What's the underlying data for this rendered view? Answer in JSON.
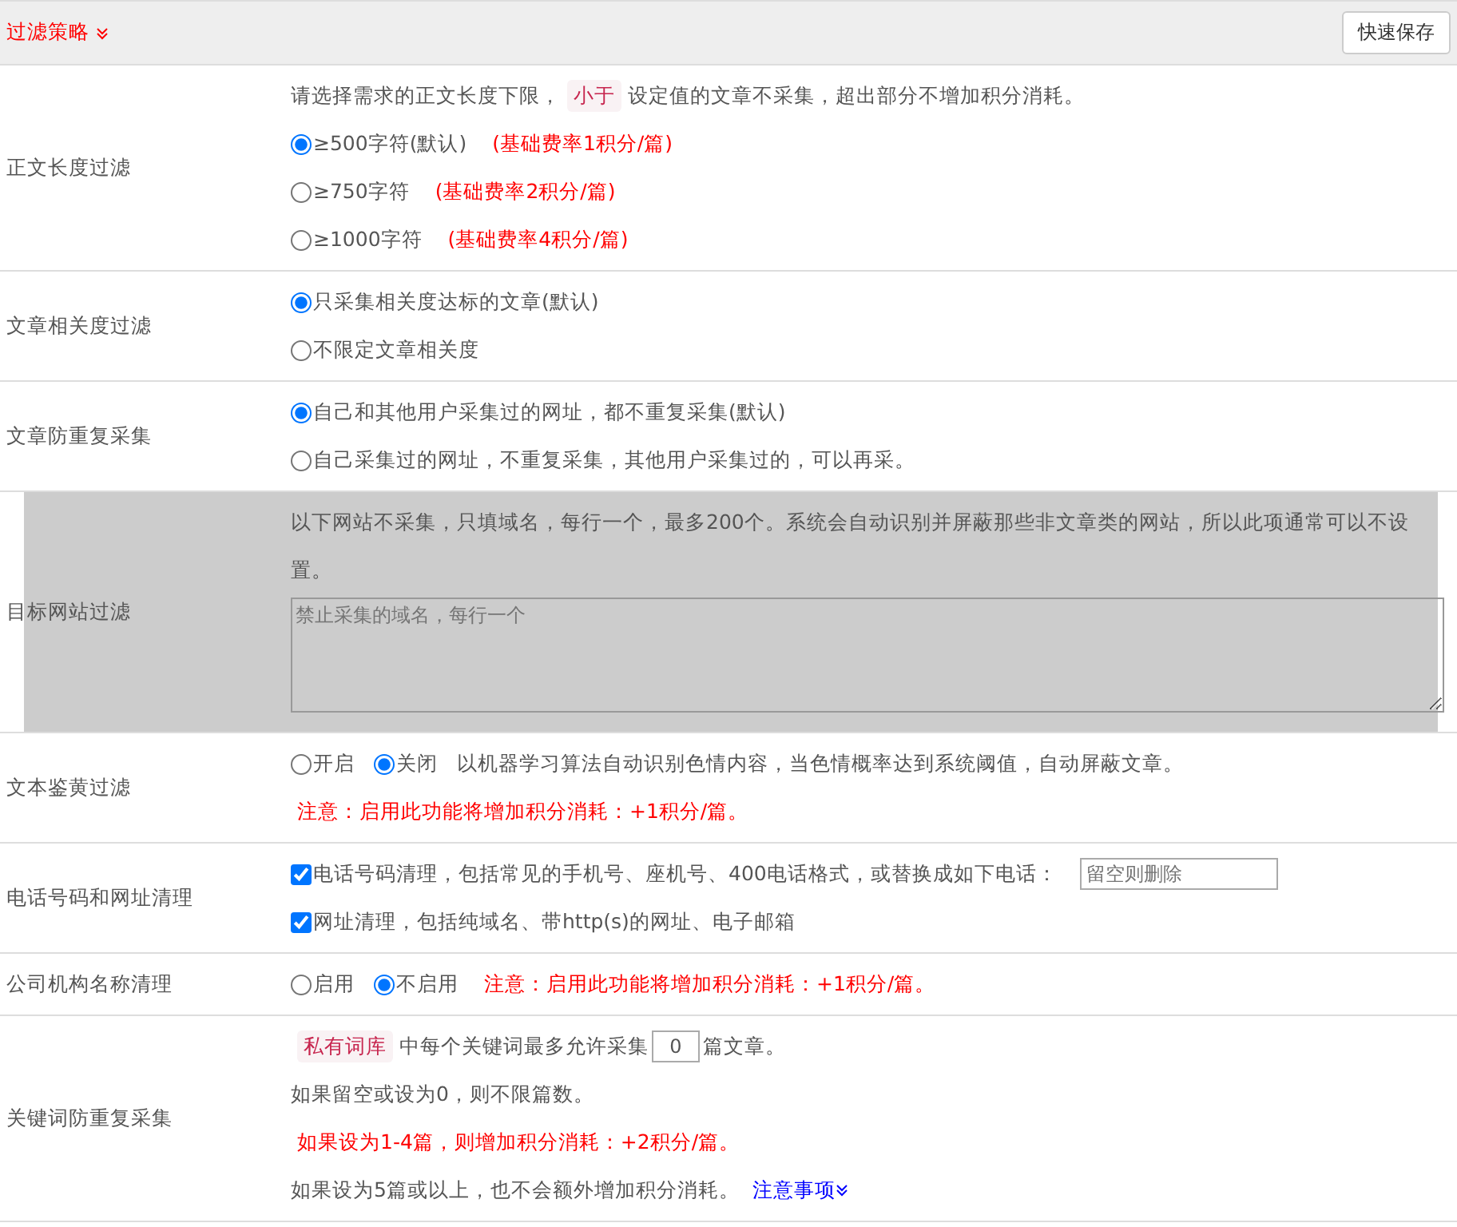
{
  "header": {
    "title": "过滤策略",
    "save_button": "快速保存"
  },
  "sections": [
    {
      "label": "正文长度过滤",
      "highlighted": false,
      "lines": [
        [
          {
            "kind": "text",
            "text": "请选择需求的正文长度下限，"
          },
          {
            "kind": "tag",
            "text": "小于"
          },
          {
            "kind": "text",
            "text": "设定值的文章不采集，超出部分不增加积分消耗。"
          }
        ],
        [
          {
            "kind": "radio",
            "label": "≥500字符(默认)",
            "selected": true
          },
          {
            "kind": "note",
            "text": "(基础费率1积分/篇)"
          }
        ],
        [
          {
            "kind": "radio",
            "label": "≥750字符",
            "selected": false
          },
          {
            "kind": "note",
            "text": "(基础费率2积分/篇)"
          }
        ],
        [
          {
            "kind": "radio",
            "label": "≥1000字符",
            "selected": false
          },
          {
            "kind": "note",
            "text": "(基础费率4积分/篇)"
          }
        ]
      ]
    },
    {
      "label": "文章相关度过滤",
      "highlighted": false,
      "lines": [
        [
          {
            "kind": "radio",
            "label": "只采集相关度达标的文章(默认)",
            "selected": true
          }
        ],
        [
          {
            "kind": "radio",
            "label": "不限定文章相关度",
            "selected": false
          }
        ]
      ]
    },
    {
      "label": "文章防重复采集",
      "highlighted": false,
      "lines": [
        [
          {
            "kind": "radio",
            "label": "自己和其他用户采集过的网址，都不重复采集(默认)",
            "selected": true
          }
        ],
        [
          {
            "kind": "radio",
            "label": "自己采集过的网址，不重复采集，其他用户采集过的，可以再采。",
            "selected": false
          }
        ]
      ]
    },
    {
      "label": "目标网站过滤",
      "highlighted": true,
      "lines": [
        [
          {
            "kind": "text",
            "text": "以下网站不采集，只填域名，每行一个，最多200个。系统会自动识别并屏蔽那些非文章类的网站，所以此项通常可以不设置。"
          }
        ],
        [
          {
            "kind": "textarea",
            "placeholder": "禁止采集的域名，每行一个"
          }
        ]
      ]
    },
    {
      "label": "文本鉴黄过滤",
      "highlighted": false,
      "lines": [
        [
          {
            "kind": "radio",
            "label": "开启",
            "selected": false
          },
          {
            "kind": "radio",
            "label": "关闭",
            "selected": true
          },
          {
            "kind": "text",
            "text": "以机器学习算法自动识别色情内容，当色情概率达到系统阈值，自动屏蔽文章。"
          }
        ],
        [
          {
            "kind": "note",
            "text": "注意：启用此功能将增加积分消耗：+1积分/篇。"
          }
        ]
      ]
    },
    {
      "label": "电话号码和网址清理",
      "highlighted": false,
      "lines": [
        [
          {
            "kind": "checkbox",
            "label": "电话号码清理，包括常见的手机号、座机号、400电话格式，或替换成如下电话：",
            "checked": true
          },
          {
            "kind": "input",
            "placeholder": "留空则删除"
          }
        ],
        [
          {
            "kind": "checkbox",
            "label": "网址清理，包括纯域名、带http(s)的网址、电子邮箱",
            "checked": true
          }
        ]
      ]
    },
    {
      "label": "公司机构名称清理",
      "highlighted": false,
      "lines": [
        [
          {
            "kind": "radio",
            "label": "启用",
            "selected": false
          },
          {
            "kind": "radio",
            "label": "不启用",
            "selected": true
          },
          {
            "kind": "note",
            "text": "注意：启用此功能将增加积分消耗：+1积分/篇。"
          }
        ]
      ]
    },
    {
      "label": "关键词防重复采集",
      "highlighted": false,
      "lines": [
        [
          {
            "kind": "tag",
            "text": "私有词库"
          },
          {
            "kind": "text",
            "text": "中每个关键词最多允许采集"
          },
          {
            "kind": "input",
            "value": "0"
          },
          {
            "kind": "text",
            "text": "篇文章。"
          }
        ],
        [
          {
            "kind": "text",
            "text": "如果留空或设为0，则不限篇数。"
          }
        ],
        [
          {
            "kind": "note",
            "text": "如果设为1-4篇，则增加积分消耗：+2积分/篇。"
          }
        ],
        [
          {
            "kind": "text",
            "text": "如果设为5篇或以上，也不会额外增加积分消耗。"
          },
          {
            "kind": "link",
            "text": "注意事项"
          }
        ]
      ]
    }
  ]
}
